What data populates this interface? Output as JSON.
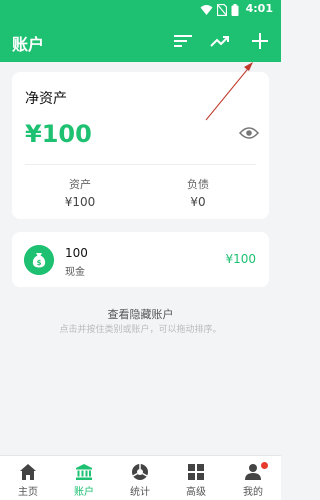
{
  "status_bar": {
    "time": "4:01",
    "icons": [
      "wifi-icon",
      "no-sim-icon",
      "battery-icon"
    ]
  },
  "app_bar": {
    "title": "账户",
    "actions": [
      "sort-icon",
      "trend-icon",
      "plus-icon"
    ]
  },
  "net_worth": {
    "title": "净资产",
    "value": "¥100",
    "assets_label": "资产",
    "assets_value": "¥100",
    "debt_label": "负债",
    "debt_value": "¥0"
  },
  "accounts": [
    {
      "amount": "100",
      "name": "现金",
      "balance": "¥100",
      "icon": "money-bag-icon"
    }
  ],
  "hidden_accounts_label": "查看隐藏账户",
  "hint": "点击并按住类别或账户，可以拖动排序。",
  "bottom_nav": [
    {
      "label": "主页",
      "icon": "home-icon",
      "active": false
    },
    {
      "label": "账户",
      "icon": "bank-icon",
      "active": true
    },
    {
      "label": "统计",
      "icon": "pie-icon",
      "active": false
    },
    {
      "label": "高级",
      "icon": "grid-icon",
      "active": false
    },
    {
      "label": "我的",
      "icon": "person-icon",
      "active": false,
      "badge": true
    }
  ],
  "colors": {
    "primary": "#1ec071",
    "badge": "#e83b30",
    "annotation_arrow": "#c0392b"
  }
}
